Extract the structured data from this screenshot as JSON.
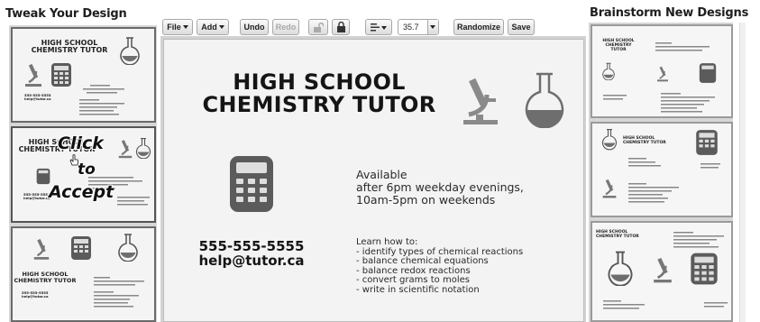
{
  "left_panel": {
    "title": "Tweak Your Design",
    "thumbs": [
      {
        "title": "HIGH SCHOOL\nCHEMISTRY TUTOR",
        "phone": "555-555-5555\nhelp@tutor.ca"
      },
      {
        "title": "HIGH SCHOOL\nCHEMISTRY TUTOR",
        "phone": "555-555-5555\nhelp@tutor.ca",
        "overlay": {
          "line1": "Click",
          "line2": "to",
          "line3": "Accept"
        }
      },
      {
        "title": "HIGH SCHOOL\nCHEMISTRY TUTOR",
        "phone": "555-555-5555\nhelp@tutor.ca"
      }
    ]
  },
  "toolbar": {
    "file": "File",
    "add": "Add",
    "undo": "Undo",
    "redo": "Redo",
    "font_size": "35.7",
    "randomize": "Randomize",
    "save": "Save"
  },
  "canvas": {
    "title": "HIGH SCHOOL\nCHEMISTRY TUTOR",
    "availability": "Available\nafter 6pm weekday evenings,\n10am-5pm on weekends",
    "phone": "555-555-5555",
    "email": "help@tutor.ca",
    "learn_heading": "Learn how to:",
    "learn_items": [
      "- identify types of chemical reactions",
      "- balance chemical equations",
      "- balance redox reactions",
      "- convert grams to moles",
      "- write in scientific notation"
    ]
  },
  "right_panel": {
    "title": "Brainstorm New Designs",
    "thumbs": [
      {
        "title": "HIGH SCHOOL\nCHEMISTRY\nTUTOR"
      },
      {
        "title": "HIGH SCHOOL\nCHEMISTRY TUTOR"
      },
      {
        "title": "HIGH SCHOOL\nCHEMISTRY TUTOR"
      }
    ]
  },
  "icons": {
    "microscope": "microscope-icon",
    "flask": "flask-icon",
    "calculator": "calculator-icon",
    "lock_open": "unlock-icon",
    "lock_closed": "lock-icon",
    "align": "align-icon",
    "hand": "hand-pointer-icon"
  },
  "colors": {
    "flask_fill": "#6e6e6e",
    "calculator": "#5b5b5b",
    "background": "#f3f3f3"
  }
}
